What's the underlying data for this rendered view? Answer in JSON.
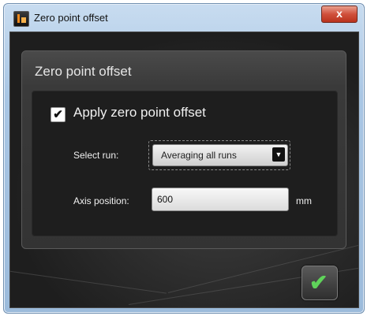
{
  "window": {
    "title": "Zero point offset",
    "close_glyph": "x",
    "icon": "app-logo-icon"
  },
  "group": {
    "title": "Zero point offset"
  },
  "apply_offset": {
    "label": "Apply zero point offset",
    "checked": true,
    "check_glyph": "✔"
  },
  "select_run": {
    "label": "Select run:",
    "value": "Averaging all runs",
    "arrow_glyph": "▼"
  },
  "axis_position": {
    "label": "Axis position:",
    "value": "600",
    "unit": "mm"
  },
  "ok_button": {
    "glyph": "✔",
    "accent": "#5fd35a"
  }
}
